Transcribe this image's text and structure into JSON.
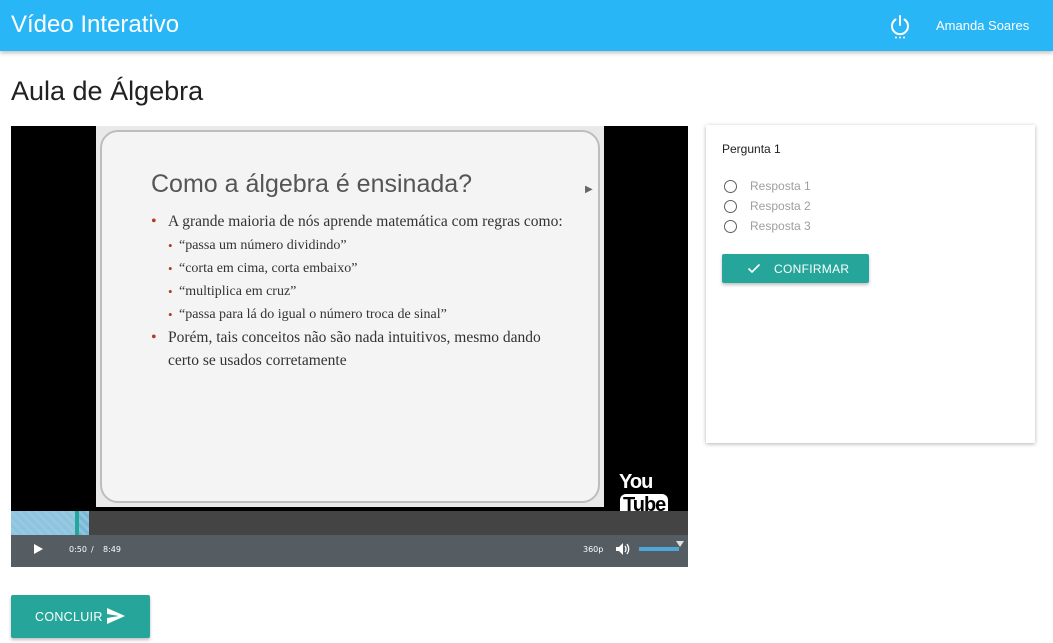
{
  "header": {
    "app_title": "Vídeo Interativo",
    "user_name": "Amanda Soares",
    "power_icon": "power-icon"
  },
  "page": {
    "title": "Aula de Álgebra"
  },
  "video": {
    "slide": {
      "heading": "Como a álgebra é ensinada?",
      "bullets": [
        {
          "text": "A grande maioria de nós aprende matemática com regras como:",
          "level": 1
        },
        {
          "text": "“passa um número dividindo”",
          "level": 2
        },
        {
          "text": "“corta em cima, corta embaixo”",
          "level": 2
        },
        {
          "text": "“multiplica em cruz”",
          "level": 2
        },
        {
          "text": "“passa para lá do igual o número troca de sinal”",
          "level": 2
        },
        {
          "text": "Porém, tais conceitos não são nada intuitivos, mesmo dando certo se usados corretamente",
          "level": 1
        }
      ]
    },
    "watermark_you": "You",
    "watermark_tube": "Tube",
    "current_time": "0:50",
    "time_separator": "/",
    "duration": "8:49",
    "quality": "360p",
    "played_fraction": 0.094,
    "buffered_fraction": 0.115,
    "volume_fraction": 1.0,
    "icons": {
      "play": "play-icon",
      "volume": "volume-icon"
    }
  },
  "question": {
    "title": "Pergunta 1",
    "options": [
      "Resposta 1",
      "Resposta 2",
      "Resposta 3"
    ],
    "confirm_label": "CONFIRMAR",
    "confirm_icon": "check-icon"
  },
  "footer": {
    "finish_label": "CONCLUIR",
    "finish_icon": "send-icon"
  },
  "colors": {
    "header": "#29b6f6",
    "accent": "#26a69a",
    "bullet": "#b23b2a"
  }
}
